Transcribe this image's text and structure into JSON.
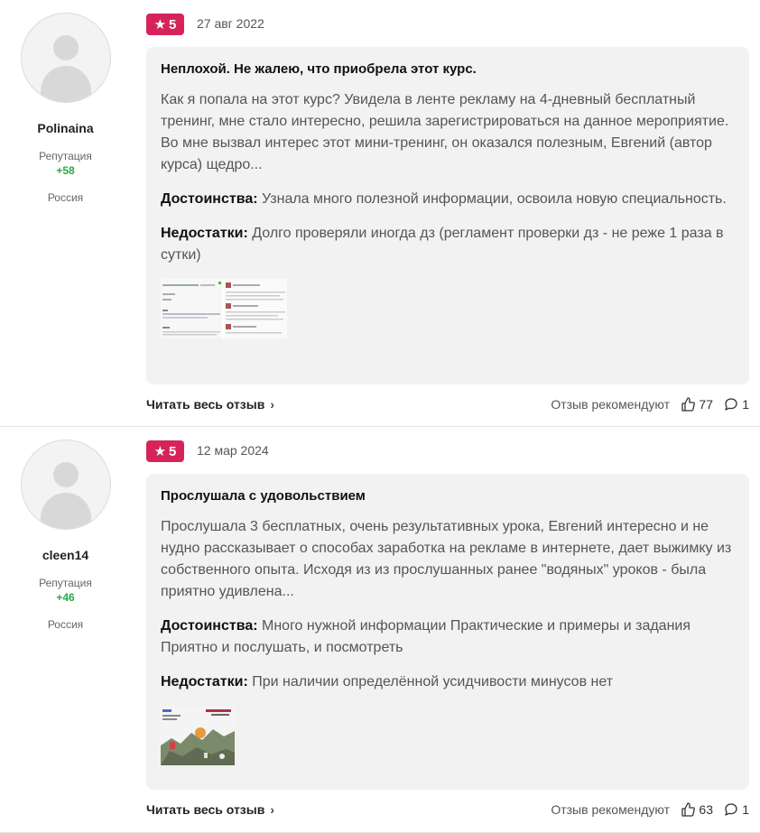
{
  "reviews": [
    {
      "username": "Polinaina",
      "reputation_label": "Репутация",
      "reputation_value": "+58",
      "country": "Россия",
      "rating": "5",
      "date": "27 авг 2022",
      "title": "Неплохой. Не жалею, что приобрела этот курс.",
      "text": "Как я попала на этот курс? Увидела в ленте рекламу на 4-дневный бесплатный тренинг, мне стало интересно, решила зарегистрироваться на данное мероприятие. Во мне вызвал интерес этот мини-тренинг, он оказался полезным, Евгений (автор курса) щедро...",
      "pros_label": "Достоинства:",
      "pros": "Узнала много полезной информации, освоила новую специальность.",
      "cons_label": "Недостатки:",
      "cons": "Долго проверяли иногда дз (регламент проверки дз - не реже 1 раза в сутки)",
      "read_all": "Читать весь отзыв",
      "recommend": "Отзыв рекомендуют",
      "likes": "77",
      "comments": "1"
    },
    {
      "username": "cleen14",
      "reputation_label": "Репутация",
      "reputation_value": "+46",
      "country": "Россия",
      "rating": "5",
      "date": "12 мар 2024",
      "title": "Прослушала с удовольствием",
      "text": "Прослушала 3 бесплатных, очень результативных урока, Евгений интересно и не нудно рассказывает о способах заработка на рекламе в интернете, дает выжимку из собственного опыта. Исходя из из прослушанных ранее \"водяных\" уроков - была приятно удивлена...",
      "pros_label": "Достоинства:",
      "pros": "Много нужной информации Практические и примеры и задания Приятно и послушать, и посмотреть",
      "cons_label": "Недостатки:",
      "cons": "При наличии определённой усидчивости минусов нет",
      "read_all": "Читать весь отзыв",
      "recommend": "Отзыв рекомендуют",
      "likes": "63",
      "comments": "1"
    }
  ],
  "colors": {
    "accent": "#d6245b",
    "reputation": "#2aa84a",
    "card_bg": "#f2f2f2"
  },
  "icons": [
    "star-icon",
    "chevron-right-icon",
    "thumbs-up-icon",
    "comment-icon",
    "avatar-placeholder-icon"
  ]
}
